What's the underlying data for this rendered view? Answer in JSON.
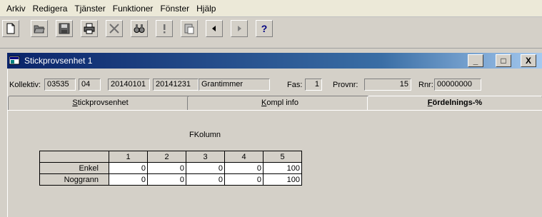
{
  "menu": {
    "items": [
      "Arkiv",
      "Redigera",
      "Tjänster",
      "Funktioner",
      "Fönster",
      "Hjälp"
    ]
  },
  "toolbar": {
    "buttons": [
      {
        "icon": "new-document-icon"
      },
      {
        "icon": "open-folder-icon"
      },
      {
        "icon": "save-icon"
      },
      {
        "icon": "print-icon"
      },
      {
        "icon": "delete-x-icon"
      },
      {
        "icon": "find-binoculars-icon"
      },
      {
        "icon": "exclamation-icon"
      },
      {
        "icon": "clipboard-icon"
      },
      {
        "icon": "previous-arrow-icon"
      },
      {
        "icon": "next-arrow-icon"
      },
      {
        "icon": "help-question-icon"
      }
    ]
  },
  "window": {
    "title": "Stickprovsenhet 1",
    "minimize_label": "_",
    "maximize_label": "□",
    "close_label": "X"
  },
  "info": {
    "kollektiv_label": "Kollektiv:",
    "kollektiv_1": "03535",
    "kollektiv_2": "04",
    "kollektiv_3": "20140101",
    "kollektiv_4": "20141231",
    "kollektiv_5": "Grantimmer",
    "fas_label": "Fas:",
    "fas_value": "1",
    "provnr_label": "Provnr:",
    "provnr_value": "15",
    "rnr_label": "Rnr:",
    "rnr_value": "00000000"
  },
  "tabs": [
    {
      "label": "Stickprovsenhet",
      "underline": "S",
      "rest": "tickprovsenhet",
      "active": false
    },
    {
      "label": "Kompl info",
      "underline": "K",
      "rest": "ompl info",
      "active": false
    },
    {
      "label": "Fördelnings-%",
      "underline": "F",
      "rest": "ördelnings-%",
      "active": true
    }
  ],
  "grid": {
    "title": "FKolumn",
    "columns": [
      "1",
      "2",
      "3",
      "4",
      "5"
    ],
    "rows": [
      {
        "label": "Enkel",
        "values": [
          "0",
          "0",
          "0",
          "0",
          "100"
        ]
      },
      {
        "label": "Noggrann",
        "values": [
          "0",
          "0",
          "0",
          "0",
          "100"
        ]
      }
    ]
  }
}
